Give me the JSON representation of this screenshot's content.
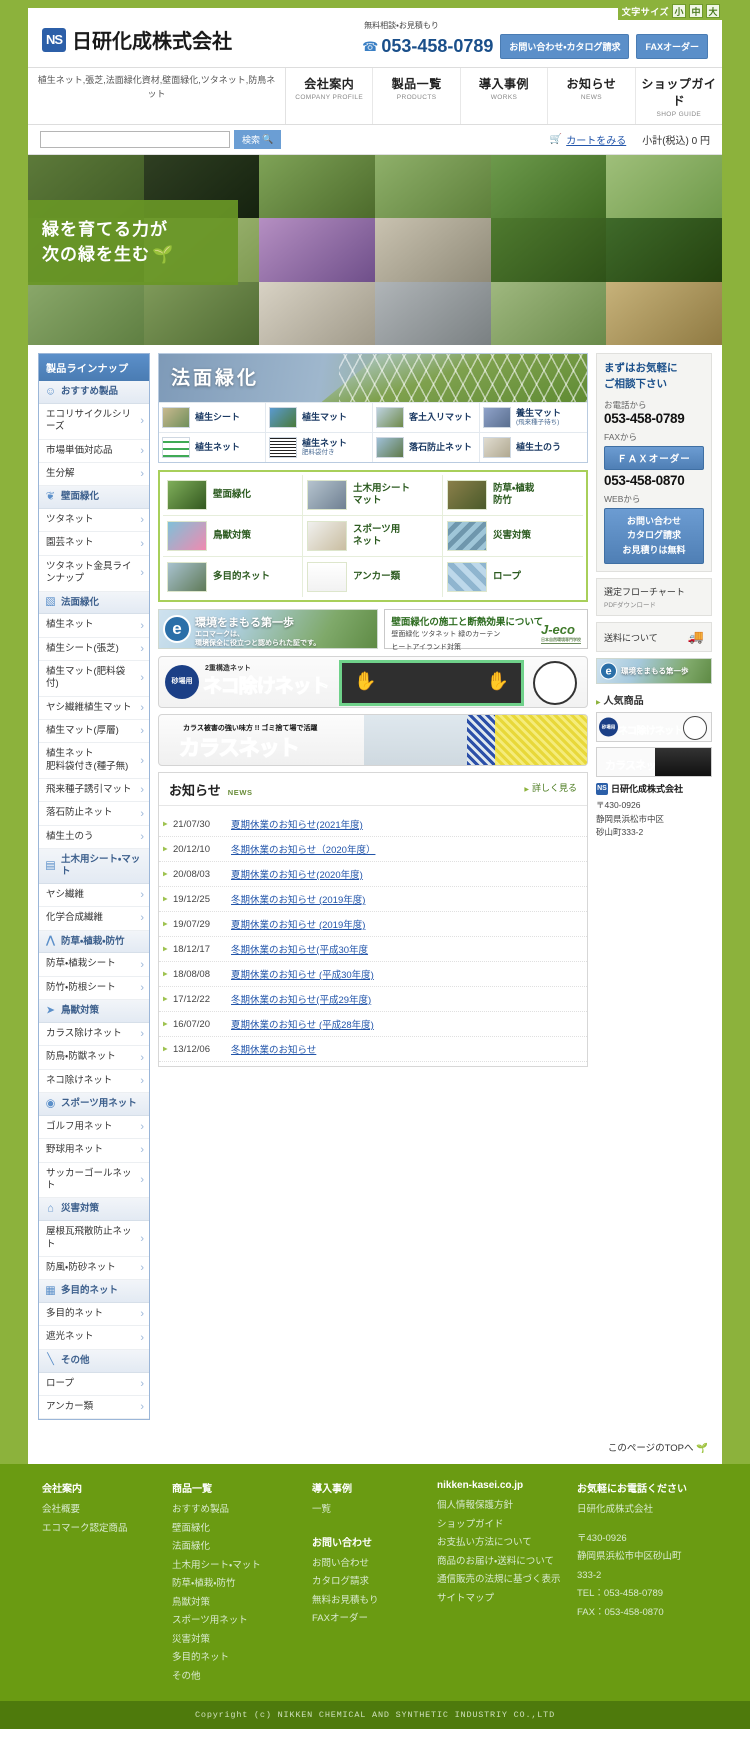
{
  "topbar": {
    "font_size_label": "文字サイズ",
    "font_sizes": [
      "小",
      "中",
      "大"
    ]
  },
  "header": {
    "logo_mark": "NS",
    "company_name": "日研化成株式会社",
    "free_consult": "無料相談・お見積もり",
    "tel": "053-458-0789",
    "tel_icon": "phone-icon",
    "btn_contact": "お問い合わせ・カタログ請求",
    "btn_fax": "FAXオーダー"
  },
  "nav": {
    "keywords": "植生ネット,張芝,法面緑化資材,壁面緑化,ツタネット,防鳥ネット",
    "items": [
      {
        "ja": "会社案内",
        "en": "COMPANY PROFILE"
      },
      {
        "ja": "製品一覧",
        "en": "PRODUCTS"
      },
      {
        "ja": "導入事例",
        "en": "WORKS"
      },
      {
        "ja": "お知らせ",
        "en": "NEWS"
      },
      {
        "ja": "ショップガイド",
        "en": "SHOP GUIDE"
      }
    ]
  },
  "search": {
    "value": "",
    "placeholder": "",
    "button": "検索",
    "cart_link": "カートをみる",
    "subtotal": "小計(税込) 0 円"
  },
  "hero": {
    "slogan_line1": "緑を育てる力が",
    "slogan_line2": "次の緑を生む"
  },
  "sidebar": {
    "title": "製品ラインナップ",
    "groups": [
      {
        "icon": "recommend-icon",
        "glyph": "☺",
        "label": "おすすめ製品",
        "items": [
          "エコリサイクルシリーズ",
          "市場単価対応品",
          "生分解"
        ]
      },
      {
        "icon": "wall-green-icon",
        "glyph": "❦",
        "label": "壁面緑化",
        "items": [
          "ツタネット",
          "園芸ネット",
          "ツタネット金具ラインナップ"
        ]
      },
      {
        "icon": "slope-green-icon",
        "glyph": "▧",
        "label": "法面緑化",
        "items": [
          "植生ネット",
          "植生シート(張芝)",
          "植生マット(肥料袋付)",
          "ヤシ繊維植生マット",
          "植生マット(厚層)",
          "植生ネット\n肥料袋付き(種子無)",
          "飛来種子誘引マット",
          "落石防止ネット",
          "植生土のう"
        ]
      },
      {
        "icon": "civil-sheet-icon",
        "glyph": "▤",
        "label": "土木用シート・マット",
        "items": [
          "ヤシ繊維",
          "化学合成繊維"
        ]
      },
      {
        "icon": "weed-icon",
        "glyph": "⋀",
        "label": "防草・植栽・防竹",
        "items": [
          "防草・植栽シート",
          "防竹・防根シート"
        ]
      },
      {
        "icon": "bird-icon",
        "glyph": "➤",
        "label": "鳥獣対策",
        "items": [
          "カラス除けネット",
          "防鳥・防獣ネット",
          "ネコ除けネット"
        ]
      },
      {
        "icon": "sports-icon",
        "glyph": "◎",
        "label": "スポーツ用ネット",
        "items": [
          "ゴルフ用ネット",
          "野球用ネット",
          "サッカーゴールネット"
        ]
      },
      {
        "icon": "disaster-icon",
        "glyph": "⌂",
        "label": "災害対策",
        "items": [
          "屋根瓦飛散防止ネット",
          "防風・防砂ネット"
        ]
      },
      {
        "icon": "multipurpose-icon",
        "glyph": "▦",
        "label": "多目的ネット",
        "items": [
          "多目的ネット",
          "遮光ネット"
        ]
      },
      {
        "icon": "other-icon",
        "glyph": "\\\\",
        "label": "その他",
        "items": [
          "ロープ",
          "アンカー類"
        ]
      }
    ]
  },
  "houmen": {
    "title": "法面緑化",
    "items": [
      {
        "label": "植生シート",
        "sub": ""
      },
      {
        "label": "植生マット",
        "sub": ""
      },
      {
        "label": "客土入リマット",
        "sub": ""
      },
      {
        "label": "養生マット",
        "sub": "(飛来種子待ち)"
      },
      {
        "label": "植生ネット",
        "sub": ""
      },
      {
        "label": "植生ネット",
        "sub": "肥料袋付き"
      },
      {
        "label": "落石防止ネット",
        "sub": ""
      },
      {
        "label": "植生土のう",
        "sub": ""
      }
    ]
  },
  "category_grid": {
    "items": [
      "壁面緑化",
      "土木用シート\nマット",
      "防草・植栽\n防竹",
      "鳥獣対策",
      "スポーツ用\nネット",
      "災害対策",
      "多目的ネット",
      "アンカー類",
      "ロープ"
    ]
  },
  "eco_banner": {
    "mark": "e",
    "title": "環境をまもる第一歩",
    "line1": "エコマークは、",
    "line2": "環境保全に役立つと認められた証です。"
  },
  "jeco_banner": {
    "title": "壁面緑化の施工と断熱効果について",
    "line1": "壁面緑化 ツタネット 緑のカーテン",
    "line2": "ヒートアイランド対策",
    "logo": "J-eco",
    "logo_sub": "日本自然環境専門学校"
  },
  "promo": {
    "neko": {
      "badge": "砂場用",
      "sub": "2重構造ネット",
      "title_main": "ネコ除け",
      "title_accent": "ネット"
    },
    "karasu": {
      "sub": "カラス被害の強い味方 !! ゴミ捨て場で活躍",
      "title": "カラスネット"
    }
  },
  "news": {
    "title_ja": "お知らせ",
    "title_en": "NEWS",
    "more": "詳しく見る",
    "items": [
      {
        "date": "21/07/30",
        "title": "夏期休業のお知らせ(2021年度)"
      },
      {
        "date": "20/12/10",
        "title": "冬期休業のお知らせ（2020年度）"
      },
      {
        "date": "20/08/03",
        "title": "夏期休業のお知らせ(2020年度)"
      },
      {
        "date": "19/12/25",
        "title": "冬期休業のお知らせ (2019年度)"
      },
      {
        "date": "19/07/29",
        "title": "夏期休業のお知らせ (2019年度)"
      },
      {
        "date": "18/12/17",
        "title": "冬期休業のお知らせ(平成30年度"
      },
      {
        "date": "18/08/08",
        "title": "夏期休業のお知らせ (平成30年度)"
      },
      {
        "date": "17/12/22",
        "title": "冬期休業のお知らせ(平成29年度)"
      },
      {
        "date": "16/07/20",
        "title": "夏期休業のお知らせ (平成28年度)"
      },
      {
        "date": "13/12/06",
        "title": "冬期休業のお知らせ"
      }
    ]
  },
  "rsidebar": {
    "head_line1": "まずはお気軽に",
    "head_line2": "ご相談下さい",
    "tel_label": "お電話から",
    "tel": "053-458-0789",
    "fax_label": "FAXから",
    "fax_btn": "ＦＡＸオーダー",
    "fax": "053-458-0870",
    "web_label": "WEBから",
    "web_btn_line1": "お問い合わせ",
    "web_btn_line2": "カタログ請求",
    "web_btn_line3": "お見積りは無料",
    "flowchart_t1": "選定フローチャート",
    "flowchart_t2": "PDFダウンロード",
    "shipping": "送料について",
    "truck_icon": "truck-icon",
    "eco_mark": "e",
    "eco_text": "環境をまもる第一歩",
    "popular_title": "人気商品",
    "pop_neko_badge": "砂場用",
    "pop_neko_main": "ネコ除け",
    "pop_neko_accent": "ネット",
    "pop_karasu": "カラスネット",
    "addr_mark": "NS",
    "addr_company": "日研化成株式会社",
    "addr_zip": "〒430-0926",
    "addr_line1": "静岡県浜松市中区",
    "addr_line2": "砂山町333-2"
  },
  "totop": "このページのTOPへ",
  "footer": {
    "col1": {
      "head": "会社案内",
      "links": [
        "会社概要",
        "エコマーク認定商品"
      ]
    },
    "col2": {
      "head": "商品一覧",
      "links": [
        "おすすめ製品",
        "壁面緑化",
        "法面緑化",
        "土木用シート・マット",
        "防草・植栽・防竹",
        "鳥獣対策",
        "スポーツ用ネット",
        "災害対策",
        "多目的ネット",
        "その他"
      ]
    },
    "col3": {
      "head": "導入事例",
      "links": [
        "一覧"
      ],
      "head2": "お問い合わせ",
      "links2": [
        "お問い合わせ",
        "カタログ請求",
        "無料お見積もり",
        "FAXオーダー"
      ]
    },
    "col4": {
      "head": "nikken-kasei.co.jp",
      "links": [
        "個人情報保護方針",
        "ショップガイド",
        "お支払い方法について",
        "商品のお届け・送料について",
        "通信販売の法規に基づく表示",
        "サイトマップ"
      ]
    },
    "col5": {
      "head": "お気軽にお電話ください",
      "company": "日研化成株式会社",
      "zip": "〒430-0926",
      "addr": "静岡県浜松市中区砂山町333-2",
      "tel": "TEL：053-458-0789",
      "fax": "FAX：053-458-0870"
    },
    "copyright": "Copyright (c) NIKKEN CHEMICAL AND SYNTHETIC INDUSTRIY CO.,LTD"
  }
}
